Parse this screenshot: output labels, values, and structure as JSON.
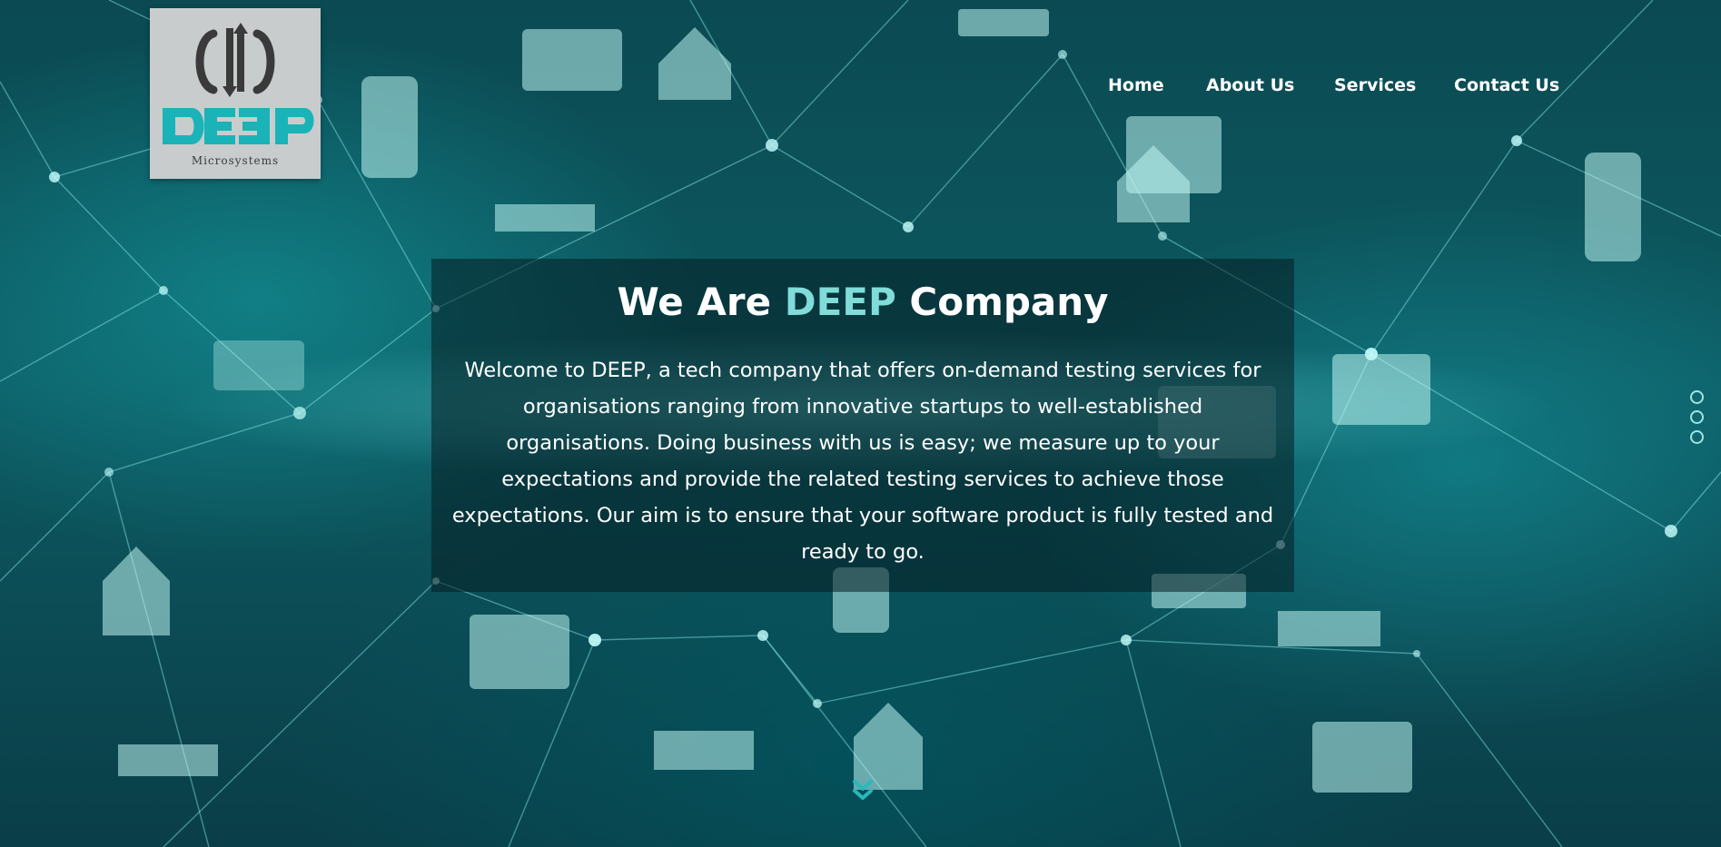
{
  "logo": {
    "brand": "DEEP",
    "tagline": "Microsystems"
  },
  "nav": {
    "items": [
      {
        "label": "Home"
      },
      {
        "label": "About Us"
      },
      {
        "label": "Services"
      },
      {
        "label": "Contact Us"
      }
    ]
  },
  "hero": {
    "title_prefix": "We Are ",
    "title_accent": "DEEP",
    "title_suffix": " Company",
    "description": "Welcome to DEEP, a tech company that offers on-demand testing services for organisations ranging from innovative startups to well-established organisations. Doing business with us is easy; we measure up to your expectations and provide the related testing services to achieve those expectations. Our aim is to ensure that your software product is fully tested and ready to go."
  },
  "slider": {
    "slide_count": 3
  },
  "icons": {
    "scroll_down": "double-chevron-down-icon",
    "background_devices": [
      "monitor-wifi-icon",
      "phone-icon",
      "house-icon",
      "car-icon",
      "router-icon"
    ]
  },
  "colors": {
    "accent": "#7fdcd8",
    "logo_bg": "#c8cccd",
    "logo_teal": "#1ab3b8",
    "logo_dark": "#3a3a3a",
    "nav_text": "#ffffff"
  }
}
